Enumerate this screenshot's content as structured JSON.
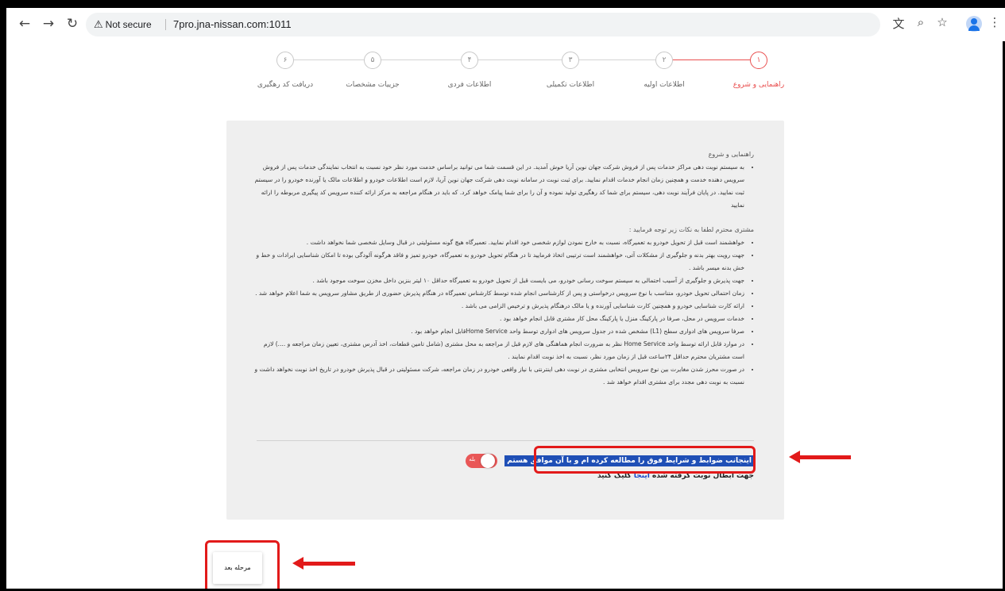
{
  "browser": {
    "security_label": "Not secure",
    "url": "7pro.jna-nissan.com:1011"
  },
  "stepper": {
    "steps": [
      {
        "number": "۶",
        "label": "دریافت کد رهگیری",
        "active": false
      },
      {
        "number": "۵",
        "label": "جزییات مشخصات",
        "active": false
      },
      {
        "number": "۴",
        "label": "اطلاعات فردی",
        "active": false
      },
      {
        "number": "۳",
        "label": "اطلاعات تکمیلی",
        "active": false
      },
      {
        "number": "۲",
        "label": "اطلاعات اولیه",
        "active": false
      },
      {
        "number": "۱",
        "label": "راهنمایی و شروع",
        "active": true
      }
    ]
  },
  "guide": {
    "title": "راهنمایی و شروع",
    "intro": "به سیستم نوبت دهی مراکز خدمات پس از فروش شرکت جهان نوین آریا خوش آمدید. در این قسمت شما می توانید براساس خدمت مورد نظر خود نسبت به انتخاب نمایندگی خدمات پس از فروش سرویس دهنده خدمت و همچنین زمان انجام خدمات اقدام نمایید. برای ثبت نوبت در سامانه نوبت دهی شرکت جهان نوین آریا، لازم است اطلاعات خودرو و اطلاعات مالک یا آورنده خودرو را در سیستم ثبت نمایید. در پایان فرآیند نوبت دهی، سیستم برای شما کد رهگیری تولید نموده و آن را برای شما پیامک خواهد کرد. که باید در هنگام مراجعه به مرکز ارائه کننده سرویس کد پیگیری مربوطه را ارائه نمایید",
    "notes_title": "مشتری محترم لطفا به نکات زیر توجه فرمایید :",
    "notes": [
      "خواهشمند است قبل از تحویل خودرو به تعمیرگاه، نسبت به خارج نمودن لوازم شخصی خود اقدام نمایید. تعمیرگاه هیچ گونه مسئولیتی در قبال وسایل شخصی شما نخواهد داشت .",
      "جهت رویت بهتر بدنه و جلوگیری از مشکلات آتی، خواهشمند است ترتیبی اتخاذ فرمایید تا در هنگام تحویل خودرو به تعمیرگاه، خودرو تمیز و فاقد هرگونه آلودگی بوده تا امکان شناسایی ایرادات و خط و خش بدنه میسر باشد .",
      "جهت پذیرش و جلوگیری از آسیب احتمالی به سیستم سوخت رسانی خودرو، می بایست قبل از تحویل خودرو به تعمیرگاه حداقل ۱۰ لیتر بنزین داخل مخزن سوخت موجود باشد .",
      "زمان احتمالی تحویل خودرو، متناسب با نوع سرویس درخواستی و پس از کارشناسی انجام شده توسط کارشناس تعمیرگاه در هنگام پذیرش حضوری از طریق مشاور سرویس به شما اعلام خواهد شد .",
      "ارائه کارت شناسایی خودرو و همچنین کارت شناسایی آورنده و یا مالک درهنگام پذیرش و ترخیص الزامی می باشد .",
      "خدمات سرویس در محل، صرفا در پارکینگ منزل یا پارکینگ محل کار مشتری قابل انجام خواهد بود .",
      "صرفا سرویس های ادواری سطح (L1) مشخص شده در جدول سرویس های ادواری توسط واحد Home Serviceقابل انجام خواهد بود .",
      "در موارد قابل ارائه توسط واحد Home Service نظر به ضرورت انجام هماهنگی های لازم قبل از مراجعه به محل مشتری (شامل تامین قطعات، اخذ آدرس مشتری، تعیین زمان مراجعه و ....) لازم است مشتریان محترم حداقل ۲۴ساعت قبل از زمان مورد نظر، نسبت به اخذ نوبت اقدام نمایند .",
      "در صورت محرز شدن مغایرت بین نوع سرویس انتخابی مشتری در نوبت دهی اینترنتی با نیاز واقعی خودرو در زمان مراجعه، شرکت مسئولیتی در قبال پذیرش خودرو در تاریخ اخذ نوبت نخواهد داشت و نسبت به نوبت دهی مجدد برای مشتری اقدام خواهد شد ."
    ]
  },
  "agreement": {
    "text": "اینجانب ضوابط و شرایط فوق را مطالعه کرده ام و با آن موافق هستم",
    "toggle_label": "بله",
    "toggle_on": true
  },
  "cancel": {
    "prefix": "جهت ابطال نوبت گرفته شده ",
    "link": "اینجا",
    "suffix": " کلیک کنید"
  },
  "next_button": "مرحله بعد",
  "colors": {
    "accent": "#e94f4f",
    "highlight_annotation": "#e21a1a",
    "selection": "#1f4fb6",
    "card_bg": "#efefef"
  }
}
